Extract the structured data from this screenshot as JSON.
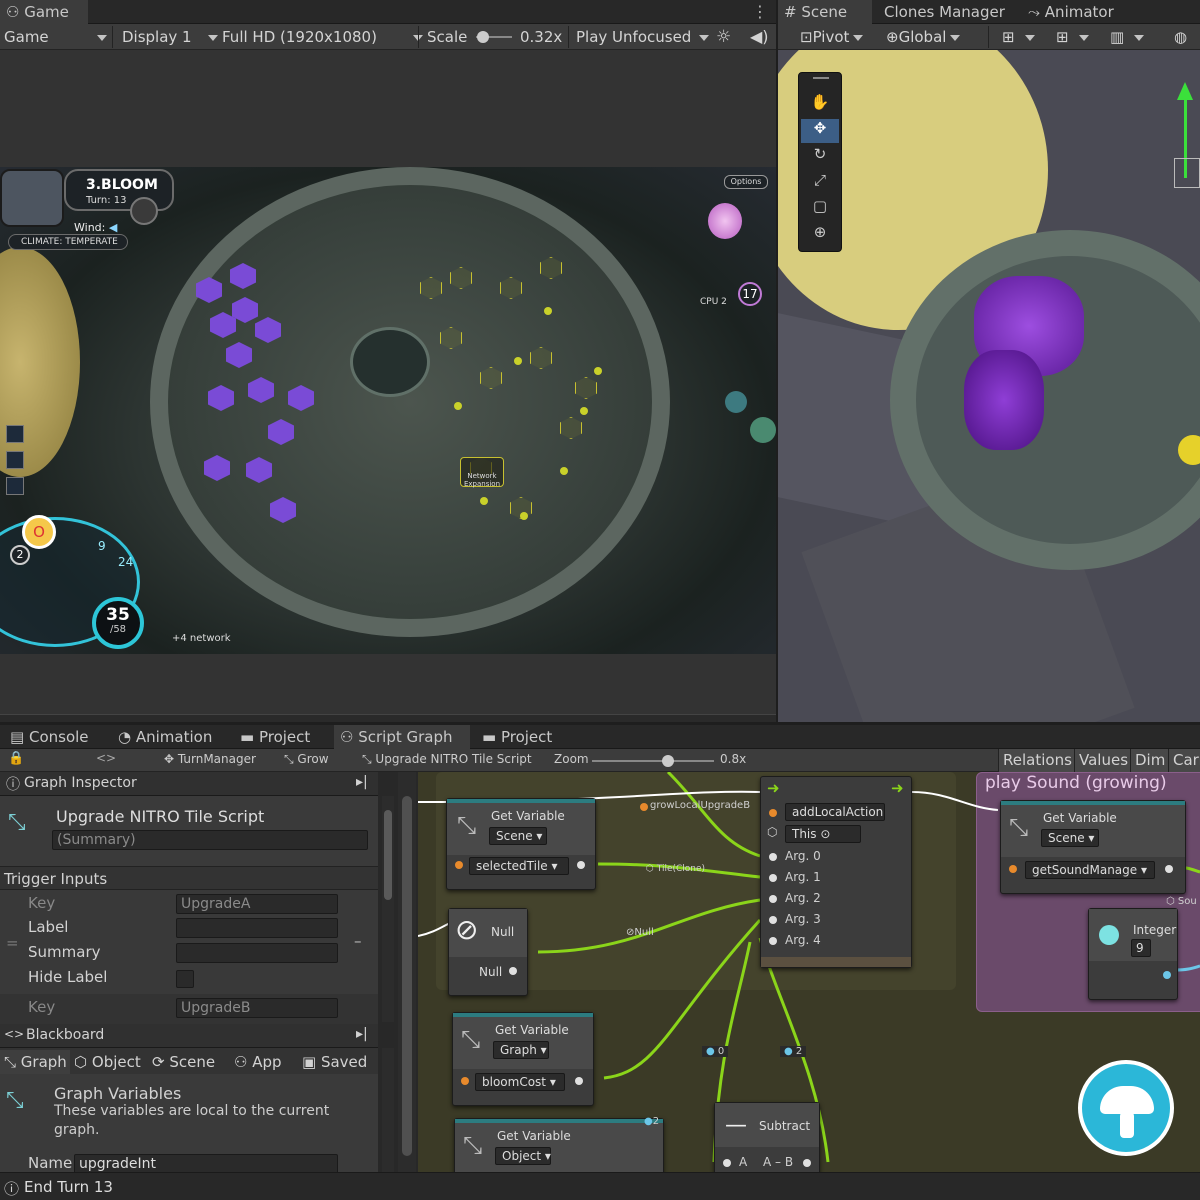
{
  "game_tabs": {
    "game": "Game",
    "scene": "Scene",
    "clones": "Clones Manager",
    "animator": "Animator"
  },
  "game_toolbar": {
    "mode": "Game",
    "display": "Display 1",
    "resolution": "Full HD (1920x1080)",
    "scale_label": "Scale",
    "scale_value": "0.32x",
    "play_mode": "Play Unfocused",
    "scale_fraction": 0.2
  },
  "scene_toolbar": {
    "pivot": "Pivot",
    "global": "Global"
  },
  "game_hud": {
    "level": "3.BLOOM",
    "turn": "Turn: 13",
    "wind": "Wind:",
    "climate": "CLIMATE: TEMPERATE",
    "options": "Options",
    "cpu": "CPU 2",
    "cpu_count": "17",
    "score": "35",
    "score_max": "/58",
    "network": "+4 network",
    "counter_o": "O",
    "counter_2": "2",
    "stat_9": "9",
    "stat_24": "24",
    "network_expand": "Network Expansion"
  },
  "bottom_tabs": {
    "console": "Console",
    "animation": "Animation",
    "project": "Project",
    "script_graph": "Script Graph",
    "project2": "Project"
  },
  "graph_toolbar": {
    "turn_manager": "TurnManager",
    "grow": "Grow",
    "upgrade_script": "Upgrade NITRO Tile Script",
    "zoom_label": "Zoom",
    "zoom_value": "0.8x",
    "zoom_fraction": 0.62,
    "relations": "Relations",
    "values": "Values",
    "dim": "Dim",
    "carry": "Carr"
  },
  "inspector": {
    "header": "Graph Inspector",
    "title": "Upgrade NITRO Tile Script",
    "summary_placeholder": "(Summary)",
    "trigger_inputs": "Trigger Inputs",
    "key_label": "Key",
    "key_a": "UpgradeA",
    "label_label": "Label",
    "summary_label": "Summary",
    "hide_label": "Hide Label",
    "key_b": "UpgradeB"
  },
  "blackboard": {
    "header": "Blackboard",
    "tabs": [
      "Graph",
      "Object",
      "Scene",
      "App",
      "Saved"
    ],
    "title": "Graph Variables",
    "desc": "These variables are local to the current graph.",
    "name_label": "Name",
    "name_value": "upgradeInt"
  },
  "graph_nodes": {
    "get_var1": {
      "title": "Get Variable",
      "scope": "Scene",
      "var": "selectedTile"
    },
    "get_var_top_label": "growLocalUpgradeB",
    "tile_clone": "Tile(Clone)",
    "null_node": {
      "title": "Null",
      "out": "Null"
    },
    "null_wire": "Null",
    "add_action": {
      "title": "addLocalAction",
      "this": "This",
      "args": [
        "Arg. 0",
        "Arg. 1",
        "Arg. 2",
        "Arg. 3",
        "Arg. 4"
      ]
    },
    "get_var2": {
      "title": "Get Variable",
      "scope": "Graph",
      "var": "bloomCost"
    },
    "get_var3": {
      "title": "Get Variable",
      "scope": "Object"
    },
    "subtract": {
      "title": "Subtract",
      "a": "A",
      "a_minus_b": "A – B"
    },
    "val0": "0",
    "val2": "2",
    "val2b": "2",
    "group_title": "play Sound (growing)",
    "get_var4": {
      "title": "Get Variable",
      "scope": "Scene",
      "var": "getSoundManage"
    },
    "integer": {
      "title": "Integer",
      "value": "9"
    },
    "sound_label": "Sou"
  },
  "status": {
    "text": "End Turn 13"
  }
}
